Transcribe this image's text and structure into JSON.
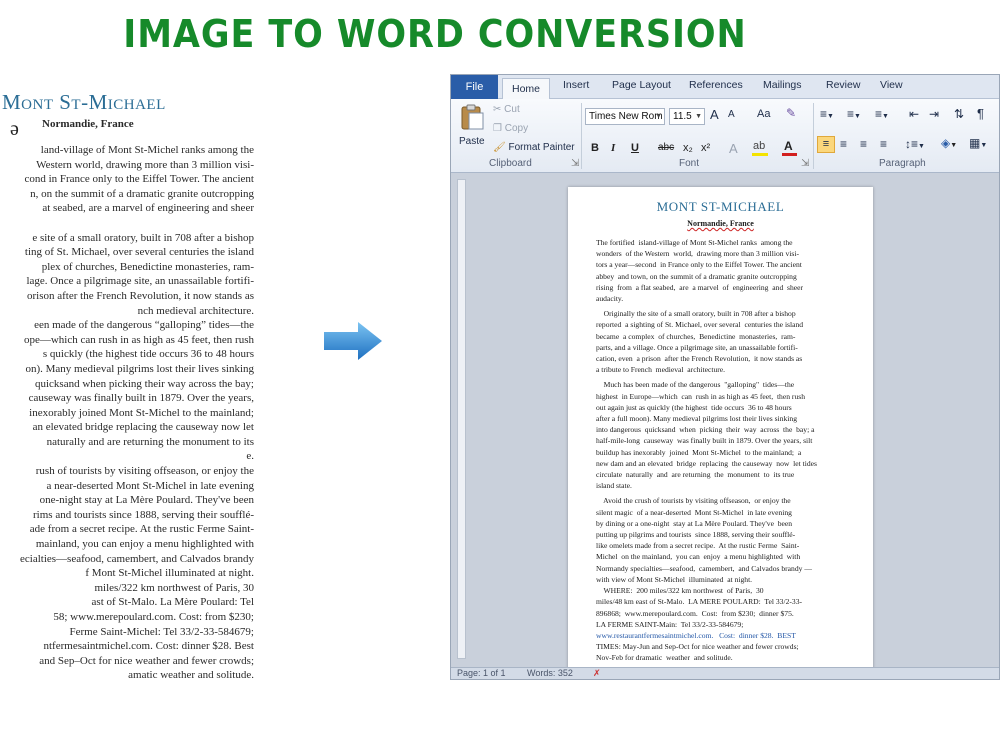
{
  "banner": "IMAGE TO WORD CONVERSION",
  "scan": {
    "title": "Mont St-Michael",
    "subtitle": "Normandie, France",
    "lines": [
      "land-village of Mont St-Michel ranks among the",
      "Western world, drawing more than 3 million visi-",
      "cond in France only to the Eiffel Tower. The ancient",
      "n, on the summit of a dramatic granite outcropping",
      "at seabed, are a marvel of engineering and sheer",
      "",
      "e site of a small oratory, built in 708 after a bishop",
      "ting of St. Michael, over several centuries the island",
      "plex of churches, Benedictine monasteries, ram-",
      "lage. Once a pilgrimage site, an unassailable fortifi-",
      "orison after the French Revolution, it now stands as",
      "nch medieval architecture.",
      "een made of the dangerous “galloping” tides—the",
      "ope—which can rush in as high as 45 feet, then rush",
      "s quickly (the highest tide occurs 36 to 48 hours",
      "on). Many medieval pilgrims lost their lives sinking",
      "quicksand when picking their way across the bay;",
      "causeway was finally built in 1879. Over the years,",
      "inexorably joined Mont St-Michel to the mainland;",
      "an elevated bridge replacing the causeway now let",
      "naturally and are returning the monument to its",
      "e.",
      "rush of tourists by visiting offseason, or enjoy the",
      "a near-deserted Mont St-Michel in late evening",
      "one-night stay at La Mère Poulard. They've been",
      "rims and tourists since 1888, serving their soufflé-",
      "ade from a secret recipe. At the rustic Ferme Saint-",
      "mainland, you can enjoy a menu highlighted with",
      "ecialties—seafood, camembert, and Calvados brandy",
      "f Mont St-Michel illuminated at night.",
      "miles/322 km northwest of Paris, 30",
      "ast of St-Malo. La Mère Poulard: Tel",
      "58; www.merepoulard.com. Cost: from $230;",
      "Ferme Saint-Michel: Tel 33/2-33-584679;",
      "ntfermesaintmichel.com. Cost: dinner $28. Best",
      "and Sep–Oct for nice weather and fewer crowds;",
      "amatic weather and solitude."
    ]
  },
  "word": {
    "tabs": [
      "File",
      "Home",
      "Insert",
      "Page Layout",
      "References",
      "Mailings",
      "Review",
      "View"
    ],
    "clipboard": {
      "paste": "Paste",
      "cut": "Cut",
      "copy": "Copy",
      "format_painter": "Format Painter",
      "label": "Clipboard"
    },
    "font": {
      "name": "Times New Rom",
      "size": "11.5",
      "label": "Font",
      "grow": "A",
      "shrink": "A",
      "case": "Aa",
      "bold": "B",
      "italic": "I",
      "underline": "U",
      "strike": "abc",
      "sub": "x₂",
      "sup": "x²"
    },
    "paragraph": {
      "label": "Paragraph"
    },
    "status": {
      "page": "Page: 1 of 1",
      "words": "Words: 352"
    },
    "colors": {
      "file_tab": "#2a5da8",
      "highlight": "#f4e300",
      "font_color": "#d21f1f"
    }
  },
  "document": {
    "title": "MONT ST-MICHAEL",
    "subtitle": "Normandie, France",
    "lines": [
      "The fortified  island-village of Mont St-Michel ranks  among the",
      "wonders  of the Western  world,  drawing more than 3 million visi-",
      "tors a year—second  in France only to the Eiffel Tower. The ancient",
      "abbey  and town, on the summit of a dramatic granite outcropping",
      "rising  from  a flat seabed,  are  a marvel  of  engineering  and  sheer",
      "audacity.",
      "    Originally the site of a small oratory, built in 708 after a bishop",
      "reported  a sighting of St. Michael, over several  centuries the island",
      "became  a complex  of churches,  Benedictine  monasteries,  ram-",
      "parts, and a village. Once a pilgrimage site, an unassailable fortifi-",
      "cation, even  a prison  after the French Revolution,  it now stands as",
      "a tribute to French  medieval  architecture.",
      "    Much has been made of the dangerous  \"galloping\"  tides—the",
      "highest  in Europe—which  can  rush in as high as 45 feet,  then rush",
      "out again just as quickly (the highest  tide occurs  36 to 48 hours",
      "after a full moon). Many medieval pilgrims lost their lives sinking",
      "into dangerous  quicksand  when  picking  their  way  across  the  bay; a",
      "half-mile-long  causeway  was finally built in 1879. Over the years, silt",
      "buildup has inexorably  joined  Mont St-Michel  to the mainland;  a",
      "new dam and an elevated  bridge  replacing  the causeway  now  let tides",
      "circulate  naturally  and  are returning  the  monument  to  its true",
      "island state.",
      "    Avoid the crush of tourists by visiting offseason,  or enjoy the",
      "silent magic  of a near-deserted  Mont St-Michel  in late evening",
      "by dining or a one-night  stay at La Mère Poulard. They've  been",
      "putting up pilgrims and tourists  since 1888, serving their soufflé-",
      "like omelets made from a secret recipe.  At the rustic Ferme  Saint-",
      "Michel  on the mainland,  you can  enjoy  a menu highlighted  with",
      "Normandy specialties—seafood,  camembert,  and Calvados brandy —",
      "with view of Mont St-Michel  illuminated  at night.",
      "    WHERE:  200 miles/322 km northwest  of Paris,  30",
      "miles/48 km east of St-Malo.  LA MERE POULARD:  Tel 33/2-33-",
      "896868;  www.merepoulard.com.  Cost:  from $230;  dinner $75.",
      "LA FERME SAINT-Main:  Tel 33/2-33-584679;",
      "www.restaurantfermesaintmichel.com.   Cost:  dinner $28.  BEST",
      "TIMES: May-Jun and Sep-Oct for nice weather and fewer crowds;",
      "Nov-Feb for dramatic  weather  and solitude."
    ]
  }
}
